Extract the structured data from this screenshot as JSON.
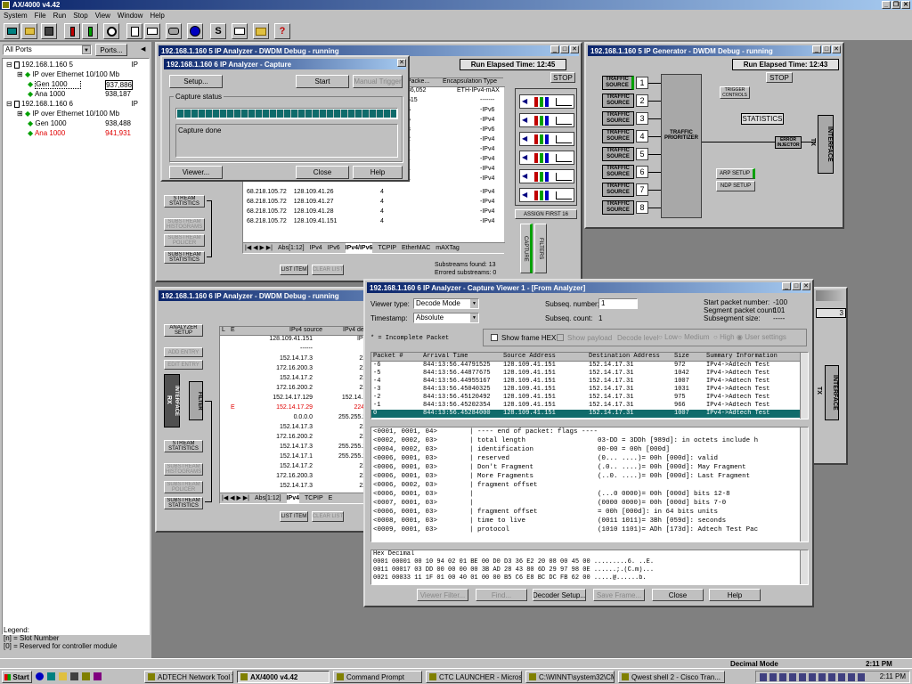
{
  "app": {
    "title": "AX/4000 v4.42"
  },
  "menu": [
    "System",
    "File",
    "Run",
    "Stop",
    "View",
    "Window",
    "Help"
  ],
  "toolbar": {
    "icons": [
      "network-icon",
      "open-icon",
      "save-icon",
      "red-battery-icon",
      "green-battery-icon",
      "clock-icon",
      "copy-icon",
      "envelope-icon",
      "phone-icon",
      "globe-icon",
      "s-icon",
      "print-icon",
      "folder-icon",
      "help-icon"
    ],
    "s_label": "S",
    "help_label": "?"
  },
  "ports": {
    "selector": "All Ports",
    "button": "Ports...",
    "tree": [
      {
        "label": "192.168.1.160 5",
        "proto": "IP"
      },
      {
        "label": "IP over Ethernet 10/100 Mb"
      },
      {
        "label": "Gen 1000",
        "value": "937,886"
      },
      {
        "label": "Ana 1000",
        "value": "938,187"
      },
      {
        "label": "192.168.1.160 6",
        "proto": "IP"
      },
      {
        "label": "IP over Ethernet 10/100 Mb"
      },
      {
        "label": "Gen 1000",
        "value": "938,488"
      },
      {
        "label": "Ana 1000",
        "value": "941,931"
      }
    ],
    "legend": [
      "Legend:",
      "[n] = Slot Number",
      "[0] = Reserved for controller module"
    ]
  },
  "an5": {
    "title": "192.168.1.160 5 IP Analyzer - DWDM Debug - running",
    "elapsed": "Run Elapsed Time: 12:45",
    "stop": "STOP",
    "headers": [
      "Packe...",
      "Encapsulation Type"
    ],
    "rows": [
      [
        "86,052",
        "ETH-IPv4-mAX"
      ],
      [
        "515",
        "-------"
      ],
      [
        "5",
        "-IPv6"
      ],
      [
        "5",
        "-IPv4"
      ],
      [
        "3",
        "-IPv6"
      ],
      [
        "2",
        "-IPv4"
      ],
      [
        "1",
        "-IPv4"
      ],
      [
        "1",
        "-IPv4"
      ],
      [
        "1",
        "-IPv4"
      ],
      [
        "1",
        "-IPv4"
      ],
      [
        "1",
        "-IPv4"
      ],
      [
        "1",
        "-IPv4"
      ],
      [
        "1",
        "-IPv4"
      ],
      [
        "1",
        "-IPv4"
      ]
    ],
    "srcrows": [
      [
        "68.218.105.72",
        "128.109.41.26",
        "4"
      ],
      [
        "68.218.105.72",
        "128.109.41.27",
        "4"
      ],
      [
        "68.218.105.72",
        "128.109.41.28",
        "4"
      ],
      [
        "68.218.105.72",
        "128.109.41.151",
        "4"
      ]
    ],
    "side": [
      "STREAM STATISTICS",
      "SUBSTREAM HISTOGRAMS",
      "SUBSTREAM POLICER",
      "SUBSTREAM STATISTICS"
    ],
    "tabs": [
      "Abs[1:12]",
      "IPv4",
      "IPv6",
      "IPv4/IPv6",
      "TCPIP",
      "EtherMAC",
      "mAXTag"
    ],
    "list_item": "LIST ITEM",
    "clear_list": "CLEAR LIST",
    "found": "Substreams found: 13",
    "errored": "Errored substreams: 0",
    "assign": "ASSIGN FIRST 16",
    "capture": "CAPTURE",
    "filters": "FILTERS"
  },
  "capture": {
    "title": "192.168.1.160 6 IP Analyzer - Capture",
    "setup": "Setup...",
    "start": "Start",
    "manual": "Manual Trigger",
    "status_label": "Capture status",
    "done": "Capture done",
    "viewer": "Viewer...",
    "close": "Close",
    "help": "Help",
    "progress": 1.0
  },
  "gen5": {
    "title": "192.168.1.160 5 IP Generator - DWDM Debug - running",
    "elapsed": "Run Elapsed Time: 12:43",
    "stop": "STOP",
    "sources": [
      "TRAFFIC SOURCE",
      "TRAFFIC SOURCE",
      "TRAFFIC SOURCE",
      "TRAFFIC SOURCE",
      "TRAFFIC SOURCE",
      "TRAFFIC SOURCE",
      "TRAFFIC SOURCE",
      "TRAFFIC SOURCE"
    ],
    "nums": [
      "1",
      "2",
      "3",
      "4",
      "5",
      "6",
      "7",
      "8"
    ],
    "prioritizer": "TRAFFIC PRIORITIZER",
    "trigger": "TRIGGER CONTROLS",
    "statistics": "STATISTICS",
    "error": "ERROR INJECTOR",
    "arp": "ARP SETUP",
    "ndp": "NDP SETUP",
    "tx": "TX",
    "interface": "INTERFACE"
  },
  "an6": {
    "title": "192.168.1.160 6 IP Analyzer - DWDM Debug - running",
    "side": [
      "ANALYZER SETUP",
      "ADD ENTRY",
      "EDIT ENTRY",
      "STREAM STATISTICS",
      "SUBSTREAM HISTOGRAMS",
      "SUBSTREAM POLICER",
      "SUBSTREAM STATISTICS"
    ],
    "rx": "RX",
    "interface": "INTERFACE",
    "filter": "FILTER",
    "headers": [
      "L",
      "E",
      "IPv4 source",
      "IPv4 dest"
    ],
    "rows": [
      [
        "",
        "",
        "128.109.41.151",
        "IPv4"
      ],
      [
        "",
        "",
        "------",
        ""
      ],
      [
        "",
        "",
        "152.14.17.3",
        "224"
      ],
      [
        "",
        "",
        "172.16.200.3",
        "224"
      ],
      [
        "",
        "",
        "152.14.17.2",
        "224"
      ],
      [
        "",
        "",
        "172.16.200.2",
        "224"
      ],
      [
        "",
        "",
        "152.14.17.129",
        "152.14.17"
      ],
      [
        "",
        "E",
        "152.14.17.29",
        "224.0"
      ],
      [
        "",
        "",
        "0.0.0.0",
        "255.255.25"
      ],
      [
        "",
        "",
        "152.14.17.3",
        "224"
      ],
      [
        "",
        "",
        "172.16.200.2",
        "224"
      ],
      [
        "",
        "",
        "152.14.17.3",
        "255.255.25"
      ],
      [
        "",
        "",
        "152.14.17.1",
        "255.255.25"
      ],
      [
        "",
        "",
        "152.14.17.2",
        "224"
      ],
      [
        "",
        "",
        "172.16.200.3",
        "224"
      ],
      [
        "",
        "",
        "152.14.17.3",
        "224"
      ]
    ],
    "tabs": [
      "Abs[1:12]",
      "IPv4",
      "TCPIP",
      "E"
    ],
    "list_item": "LIST ITEM",
    "clear_list": "CLEAR LIST"
  },
  "viewer": {
    "title": "192.168.1.160 6 IP Analyzer - Capture Viewer 1 - [From Analyzer]",
    "viewer_type_label": "Viewer type:",
    "viewer_type": "Decode Mode",
    "timestamp_label": "Timestamp:",
    "timestamp": "Absolute",
    "subseq_label": "Subseq. number:",
    "subseq": "1",
    "subseq_count_label": "Subseq. count:",
    "subseq_count": "1",
    "start_pkt": "Start packet number:",
    "start_pkt_val": "-100",
    "seg_count": "Segment packet count:",
    "seg_count_val": "101",
    "subseg_size": "Subsegment size:",
    "subseg_size_val": "-----",
    "incomplete": "* = Incomplete Packet",
    "show_hex": "Show frame HEX",
    "show_payload": "Show payload",
    "decode_level": "Decode level",
    "low": "Low",
    "medium": "Medium",
    "high": "High",
    "user": "User settings",
    "headers": [
      "Packet #",
      "Arrival Time",
      "Source Address",
      "Destination Address",
      "Size",
      "Summary Information"
    ],
    "packets": [
      [
        "-6",
        "844:13:56.44791525",
        "128.109.41.151",
        "152.14.17.31",
        "972",
        "IPv4->Adtech Test"
      ],
      [
        "-5",
        "844:13:56.44877675",
        "128.109.41.151",
        "152.14.17.31",
        "1042",
        "IPv4->Adtech Test"
      ],
      [
        "-4",
        "844:13:56.44955167",
        "128.109.41.151",
        "152.14.17.31",
        "1007",
        "IPv4->Adtech Test"
      ],
      [
        "-3",
        "844:13:56.45040325",
        "128.109.41.151",
        "152.14.17.31",
        "1031",
        "IPv4->Adtech Test"
      ],
      [
        "-2",
        "844:13:56.45120492",
        "128.109.41.151",
        "152.14.17.31",
        "975",
        "IPv4->Adtech Test"
      ],
      [
        "-1",
        "844:13:56.45202354",
        "128.109.41.151",
        "152.14.17.31",
        "966",
        "IPv4->Adtech Test"
      ],
      [
        "0",
        "844:13:56.45284000",
        "128.109.41.151",
        "152.14.17.31",
        "1007",
        "IPv4->Adtech Test"
      ]
    ],
    "decode": [
      "<0001, 0001, 04>        | ---- end of packet: flags ----",
      "<0002, 0002, 03>        | total length                  03-DD = 3DDh [989d]: in octets include h",
      "<0004, 0002, 03>        | identification                00-00 = 00h [000d]",
      "<0006, 0001, 03>        | reserved                      (0... ....)= 00h [000d]: valid",
      "<0006, 0001, 03>        | Don't Fragment                (.0.. ....)= 00h [000d]: May Fragment",
      "<0006, 0001, 03>        | More Fragments                (..0. ....)= 00h [000d]: Last Fragment",
      "<0006, 0002, 03>        | fragment offset",
      "<0006, 0001, 03>        |                               (...0 0000)= 00h [000d] bits 12-8",
      "<0007, 0001, 03>        |                               (0000 0000)= 00h [000d] bits 7-0",
      "<0006, 0001, 03>        | fragment offset               = 00h [000d]: in 64 bits units",
      "<0008, 0001, 03>        | time to live                  (0011 1011)= 3Bh [059d]: seconds",
      "<0009, 0001, 03>        | protocol                      (1010 1101)= ADh [173d]: Adtech Test Pac"
    ],
    "hex": [
      "Hex  Decimal",
      "0001  00001    00 10 94 02 01 BE 00 D0 D3 36 E2 20 08 00 45 00    .........6. ..E.",
      "0011  00017    03 DD 00 00 00 00 3B AD 28 43 80 6D 29 97 98 0E    ......;.(C.m)...",
      "0021  00033    11 1F 01 00 40 01 00 00 B5 C6 E8 BC DC FB 62 00    .....@......b."
    ],
    "filter": "Viewer Filter...",
    "find": "Find...",
    "decoder": "Decoder Setup...",
    "save": "Save Frame...",
    "close": "Close",
    "help": "Help"
  },
  "right_partial": {
    "tx": "TX",
    "interface": "INTERFACE",
    "label": "3"
  },
  "status": {
    "text": "Decimal Mode",
    "time": "2:11 PM"
  },
  "taskbar": {
    "start": "Start",
    "items": [
      "ADTECH Network Tool V4...",
      "AX/4000 v4.42",
      "Command Prompt",
      "CTC LAUNCHER - Micros...",
      "C:\\WINNT\\system32\\CM...",
      "Qwest shell 2 - Cisco Tran..."
    ],
    "time": "2:11 PM"
  },
  "colors": {
    "title_active": "#0a246a",
    "face": "#c0c0c0",
    "desktop": "#808080",
    "select": "#0f6b6b",
    "green": "#00a000",
    "red": "#e00000"
  }
}
